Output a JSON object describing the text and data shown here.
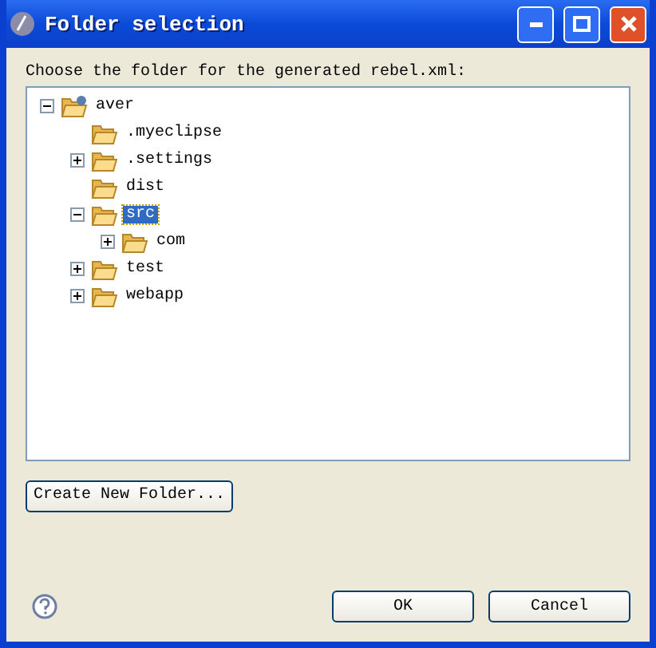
{
  "window": {
    "title": "Folder selection"
  },
  "prompt": "Choose the folder for the generated rebel.xml:",
  "tree": [
    {
      "label": "aver",
      "kind": "project",
      "expanded": true,
      "selected": false,
      "children": [
        {
          "label": ".myeclipse",
          "kind": "folder",
          "selected": false
        },
        {
          "label": ".settings",
          "kind": "folder",
          "expanded": false,
          "selected": false
        },
        {
          "label": "dist",
          "kind": "folder",
          "selected": false
        },
        {
          "label": "src",
          "kind": "folder",
          "expanded": true,
          "selected": true,
          "children": [
            {
              "label": "com",
              "kind": "folder",
              "expanded": false,
              "selected": false
            }
          ]
        },
        {
          "label": "test",
          "kind": "folder",
          "expanded": false,
          "selected": false
        },
        {
          "label": "webapp",
          "kind": "folder",
          "expanded": false,
          "selected": false
        }
      ]
    }
  ],
  "create_button": "Create New Folder...",
  "buttons": [
    "OK",
    "Cancel"
  ]
}
